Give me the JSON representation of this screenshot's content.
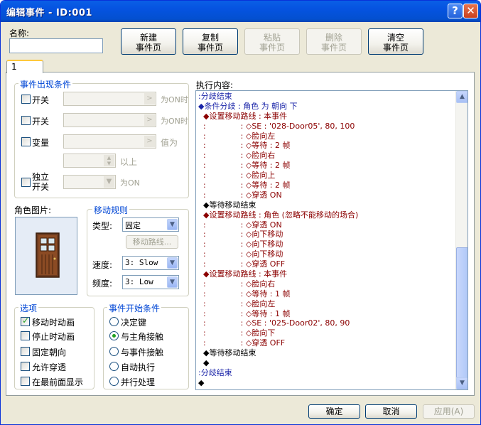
{
  "window": {
    "title": "编辑事件 - ID:001",
    "help_glyph": "?",
    "close_glyph": "✕"
  },
  "name_label": "名称:",
  "name_value": "",
  "toolbar": [
    {
      "line1": "新建",
      "line2": "事件页",
      "enabled": true
    },
    {
      "line1": "复制",
      "line2": "事件页",
      "enabled": true
    },
    {
      "line1": "粘贴",
      "line2": "事件页",
      "enabled": false
    },
    {
      "line1": "删除",
      "line2": "事件页",
      "enabled": false
    },
    {
      "line1": "清空",
      "line2": "事件页",
      "enabled": true
    }
  ],
  "tab_label": "1",
  "conditions": {
    "title": "事件出现条件",
    "switch1": {
      "label": "开关",
      "suffix": "为ON时",
      "checked": false
    },
    "switch2": {
      "label": "开关",
      "suffix": "为ON时",
      "checked": false
    },
    "variable": {
      "label": "变量",
      "suffix": "值为",
      "above": "以上",
      "checked": false
    },
    "self_switch": {
      "label_line1": "独立",
      "label_line2": "开关",
      "suffix": "为ON",
      "checked": false
    }
  },
  "graphic_label": "角色图片:",
  "movement": {
    "title": "移动规则",
    "type_label": "类型:",
    "type_value": "固定",
    "route_button": "移动路线...",
    "speed_label": "速度:",
    "speed_value": "3: Slow",
    "freq_label": "频度:",
    "freq_value": "3: Low"
  },
  "options": {
    "title": "选项",
    "items": [
      {
        "label": "移动时动画",
        "checked": true
      },
      {
        "label": "停止时动画",
        "checked": false
      },
      {
        "label": "固定朝向",
        "checked": false
      },
      {
        "label": "允许穿透",
        "checked": false
      },
      {
        "label": "在最前面显示",
        "checked": false
      }
    ]
  },
  "trigger": {
    "title": "事件开始条件",
    "items": [
      {
        "label": "决定键",
        "checked": false
      },
      {
        "label": "与主角接触",
        "checked": true
      },
      {
        "label": "与事件接触",
        "checked": false
      },
      {
        "label": "自动执行",
        "checked": false
      },
      {
        "label": "并行处理",
        "checked": false
      }
    ]
  },
  "contents_label": "执行内容:",
  "commands": [
    {
      "text": ":分歧结束",
      "color": "blue"
    },
    {
      "text": "◆条件分歧 : 角色 为 朝向 下",
      "color": "blue"
    },
    {
      "text": "  ◆设置移动路线 : 本事件",
      "color": "red"
    },
    {
      "text": "  :              : ◇SE : '028-Door05', 80, 100",
      "color": "red"
    },
    {
      "text": "  :              : ◇脸向左",
      "color": "red"
    },
    {
      "text": "  :              : ◇等待 : 2 帧",
      "color": "red"
    },
    {
      "text": "  :              : ◇脸向右",
      "color": "red"
    },
    {
      "text": "  :              : ◇等待 : 2 帧",
      "color": "red"
    },
    {
      "text": "  :              : ◇脸向上",
      "color": "red"
    },
    {
      "text": "  :              : ◇等待 : 2 帧",
      "color": "red"
    },
    {
      "text": "  :              : ◇穿透 ON",
      "color": "red"
    },
    {
      "text": "  ◆等待移动结束",
      "color": "black"
    },
    {
      "text": "  ◆设置移动路线 : 角色 (忽略不能移动的场合)",
      "color": "red"
    },
    {
      "text": "  :              : ◇穿透 ON",
      "color": "red"
    },
    {
      "text": "  :              : ◇向下移动",
      "color": "red"
    },
    {
      "text": "  :              : ◇向下移动",
      "color": "red"
    },
    {
      "text": "  :              : ◇向下移动",
      "color": "red"
    },
    {
      "text": "  :              : ◇穿透 OFF",
      "color": "red"
    },
    {
      "text": "  ◆设置移动路线 : 本事件",
      "color": "red"
    },
    {
      "text": "  :              : ◇脸向右",
      "color": "red"
    },
    {
      "text": "  :              : ◇等待 : 1 帧",
      "color": "red"
    },
    {
      "text": "  :              : ◇脸向左",
      "color": "red"
    },
    {
      "text": "  :              : ◇等待 : 1 帧",
      "color": "red"
    },
    {
      "text": "  :              : ◇SE : '025-Door02', 80, 90",
      "color": "red"
    },
    {
      "text": "  :              : ◇脸向下",
      "color": "red"
    },
    {
      "text": "  :              : ◇穿透 OFF",
      "color": "red"
    },
    {
      "text": "  ◆等待移动结束",
      "color": "black"
    },
    {
      "text": "  ◆",
      "color": "black"
    },
    {
      "text": ":分歧结束",
      "color": "blue"
    },
    {
      "text": "◆",
      "color": "black"
    }
  ],
  "footer": {
    "ok": "确定",
    "cancel": "取消",
    "apply": "应用(A)"
  }
}
